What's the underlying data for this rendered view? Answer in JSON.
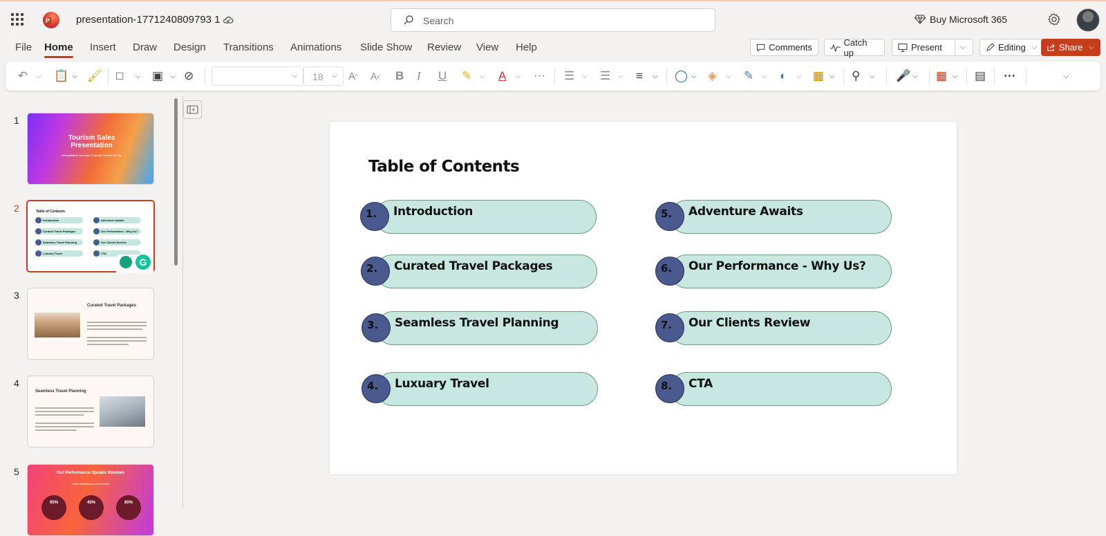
{
  "app": {
    "doc_title": "presentation-1771240809793 1",
    "search_placeholder": "Search",
    "buy_label": "Buy Microsoft 365"
  },
  "menu": {
    "items": [
      "File",
      "Home",
      "Insert",
      "Draw",
      "Design",
      "Transitions",
      "Animations",
      "Slide Show",
      "Review",
      "View",
      "Help"
    ],
    "active": "Home"
  },
  "header_buttons": {
    "comments": "Comments",
    "catch_up": "Catch up",
    "present": "Present",
    "editing": "Editing",
    "share": "Share"
  },
  "ribbon": {
    "font_size": "18"
  },
  "thumbnails": {
    "numbers": [
      "1",
      "2",
      "3",
      "4",
      "5"
    ],
    "selected": 2,
    "slide1": {
      "title": "Tourism Sales Presentation",
      "subtitle": "Unforgettable Journeys, Expertly Planned for You"
    },
    "slide2": {
      "title": "Table of Contents"
    },
    "slide3": {
      "title": "Curated Travel Packages"
    },
    "slide4": {
      "title": "Seamless Travel Planning"
    },
    "slide5": {
      "title": "Our Performance Speaks Volumes",
      "subtitle": "Client Satisfaction and Growth",
      "stats": [
        "95%",
        "40%",
        "80%"
      ]
    }
  },
  "slide": {
    "title": "Table of Contents",
    "items": [
      {
        "num": "1.",
        "label": "Introduction"
      },
      {
        "num": "2.",
        "label": "Curated Travel Packages"
      },
      {
        "num": "3.",
        "label": "Seamless Travel Planning"
      },
      {
        "num": "4.",
        "label": "Luxuary Travel"
      },
      {
        "num": "5.",
        "label": "Adventure Awaits"
      },
      {
        "num": "6.",
        "label": "Our Performance - Why Us?"
      },
      {
        "num": "7.",
        "label": "Our Clients Review"
      },
      {
        "num": "8.",
        "label": "CTA"
      }
    ]
  },
  "colors": {
    "accent": "#c43e1c",
    "pill_fill": "#c7e7e0",
    "bubble_fill": "#4a5a8e"
  }
}
